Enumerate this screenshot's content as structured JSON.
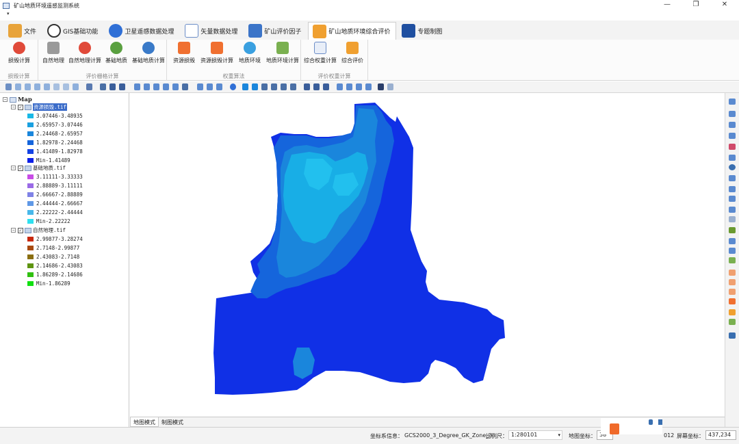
{
  "app": {
    "title": "矿山地质环境遥感监测系统"
  },
  "window_controls": {
    "minimize": "—",
    "restore": "❐",
    "close": "✕"
  },
  "qat": {
    "arrow": "▾"
  },
  "tabs": [
    {
      "label": "文件",
      "icon": "folder-icon",
      "color": "#e8a33a"
    },
    {
      "label": "GIS基础功能",
      "icon": "gis-globe-icon",
      "color": "#333333"
    },
    {
      "label": "卫星遥感数据处理",
      "icon": "satellite-icon",
      "color": "#2f6fd6"
    },
    {
      "label": "矢量数据处理",
      "icon": "vector-grid-icon",
      "color": "#6a8cc7"
    },
    {
      "label": "矿山评价因子",
      "icon": "mountain-factor-icon",
      "color": "#3b74c8"
    },
    {
      "label": "矿山地质环境综合评价",
      "icon": "shield-evaluate-icon",
      "color": "#f0a030"
    },
    {
      "label": "专题制图",
      "icon": "thematic-map-icon",
      "color": "#1f4fa0"
    }
  ],
  "ribbon": {
    "groups": [
      {
        "label": "损毁计算",
        "buttons": [
          {
            "label": "损毁计算",
            "icon": "damage-calc-icon"
          }
        ]
      },
      {
        "label": "评价栅格计算",
        "buttons": [
          {
            "label": "自然地理",
            "icon": "natural-geo-icon"
          },
          {
            "label": "自然地理计算",
            "icon": "natural-geo-calc-icon"
          },
          {
            "label": "基础地质",
            "icon": "basic-geology-icon"
          },
          {
            "label": "基础地质计算",
            "icon": "basic-geology-calc-icon"
          }
        ]
      },
      {
        "label": "权重算法",
        "buttons": [
          {
            "label": "资源损毁",
            "icon": "resource-damage-icon"
          },
          {
            "label": "资源损毁计算",
            "icon": "resource-damage-calc-icon"
          },
          {
            "label": "地质环境",
            "icon": "geo-environment-icon"
          },
          {
            "label": "地质环境计算",
            "icon": "geo-environment-calc-icon"
          }
        ]
      },
      {
        "label": "评价权重计算",
        "buttons": [
          {
            "label": "综合权重计算",
            "icon": "weight-calc-icon"
          },
          {
            "label": "综合评价",
            "icon": "comprehensive-eval-icon"
          }
        ]
      }
    ]
  },
  "layers": {
    "root": "Map",
    "items": [
      {
        "name": "资源损毁.tif",
        "classes": [
          {
            "label": "3.07446-3.48935",
            "color": "#19b8e6"
          },
          {
            "label": "2.65957-3.07446",
            "color": "#1aa0e0"
          },
          {
            "label": "2.24468-2.65957",
            "color": "#1a86dc"
          },
          {
            "label": "1.82978-2.24468",
            "color": "#1565dc"
          },
          {
            "label": "1.41489-1.82978",
            "color": "#1443e4"
          },
          {
            "label": "Min-1.41489",
            "color": "#0c1fe8"
          }
        ]
      },
      {
        "name": "基础地质.tif",
        "classes": [
          {
            "label": "3.11111-3.33333",
            "color": "#c84ce6"
          },
          {
            "label": "2.88889-3.11111",
            "color": "#9a6ae6"
          },
          {
            "label": "2.66667-2.88889",
            "color": "#7f82e6"
          },
          {
            "label": "2.44444-2.66667",
            "color": "#5f98e6"
          },
          {
            "label": "2.22222-2.44444",
            "color": "#48b8ea"
          },
          {
            "label": "Min-2.22222",
            "color": "#2ee0f0"
          }
        ]
      },
      {
        "name": "自然地理.tif",
        "classes": [
          {
            "label": "2.99877-3.28274",
            "color": "#c8280e"
          },
          {
            "label": "2.7148-2.99877",
            "color": "#a84a10"
          },
          {
            "label": "2.43083-2.7148",
            "color": "#8a6e10"
          },
          {
            "label": "2.14686-2.43083",
            "color": "#5e9410"
          },
          {
            "label": "1.86289-2.14686",
            "color": "#30c010"
          },
          {
            "label": "Min-1.86289",
            "color": "#10e010"
          }
        ]
      }
    ]
  },
  "map_tabs": [
    "地图模式",
    "制图模式"
  ],
  "status": {
    "crs_label": "坐标系信息：",
    "crs_value": "GCS2000_3_Degree_GK_Zone_3",
    "scale_label": "比例尺：",
    "scale_value": "1:280101",
    "map_coord_label": "地图坐标：",
    "map_coord_value": "38",
    "map_coord_tail": "012",
    "screen_coord_label": "屏幕坐标：",
    "screen_coord_value": "437,234"
  }
}
